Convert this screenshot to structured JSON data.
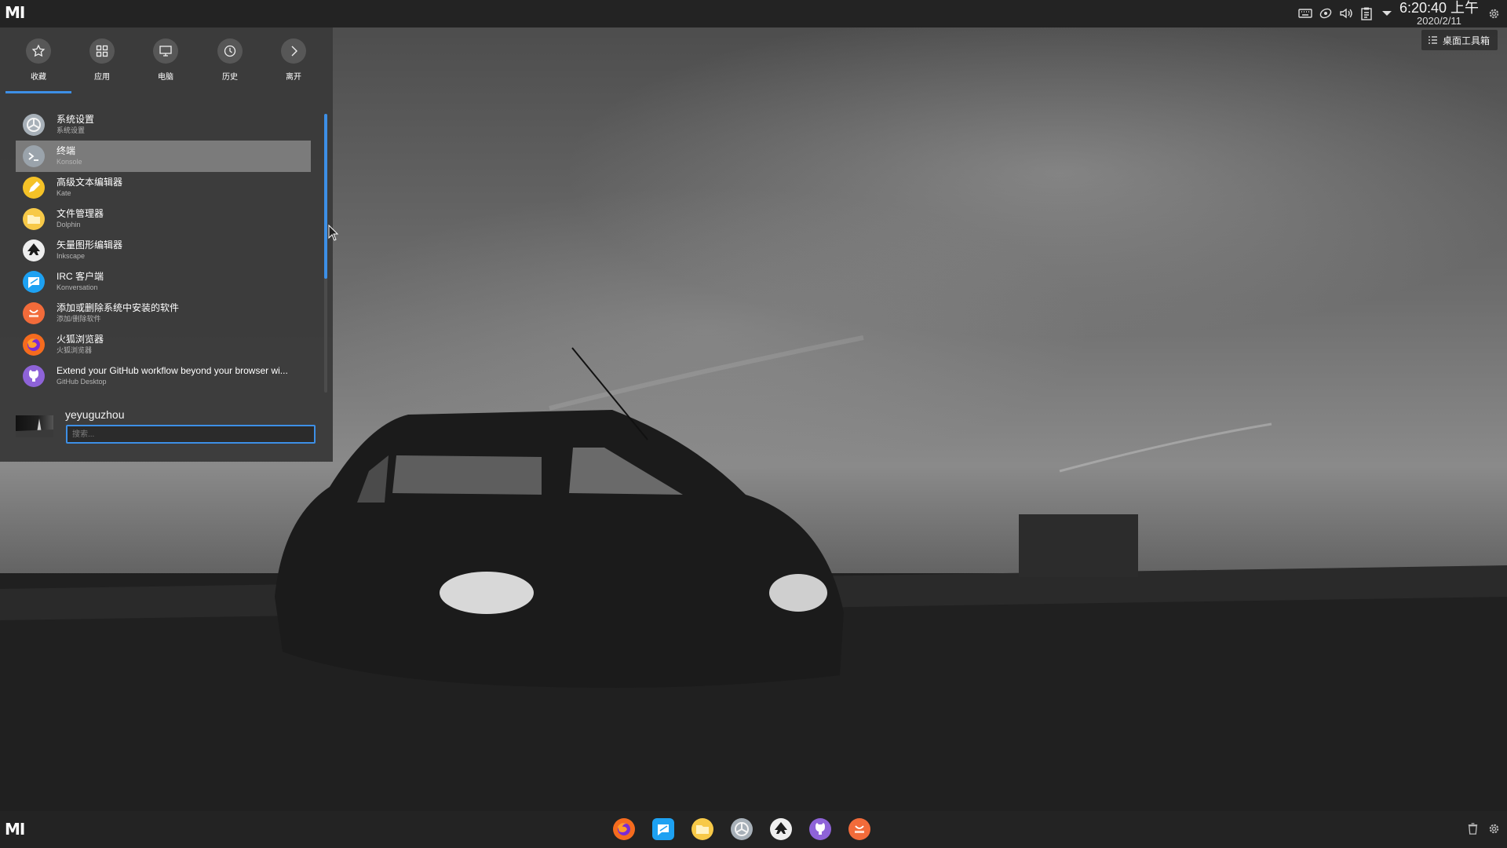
{
  "top_panel": {
    "logo": "MI",
    "tray_icons": [
      "keyboard-icon",
      "network-icon",
      "volume-icon",
      "clipboard-icon",
      "expand-arrow-icon"
    ],
    "clock_time": "6:20:40 上午",
    "clock_date": "2020/2/11"
  },
  "desktop_toolbox": {
    "label": "桌面工具箱"
  },
  "launcher": {
    "tabs": [
      {
        "label": "收藏",
        "icon": "star-icon"
      },
      {
        "label": "应用",
        "icon": "grid-icon"
      },
      {
        "label": "电脑",
        "icon": "monitor-icon"
      },
      {
        "label": "历史",
        "icon": "clock-icon"
      },
      {
        "label": "离开",
        "icon": "chevron-right-icon"
      }
    ],
    "active_tab": "收藏",
    "apps": [
      {
        "name": "系统设置",
        "sub": "系统设置",
        "icon": "settings-icon",
        "color": "#a7b0b8"
      },
      {
        "name": "终端",
        "sub": "Konsole",
        "icon": "terminal-icon",
        "color": "#9aa3ab"
      },
      {
        "name": "高级文本编辑器",
        "sub": "Kate",
        "icon": "pencil-icon",
        "color": "#f5c227"
      },
      {
        "name": "文件管理器",
        "sub": "Dolphin",
        "icon": "folder-icon",
        "color": "#f7c948"
      },
      {
        "name": "矢量图形编辑器",
        "sub": "Inkscape",
        "icon": "inkscape-icon",
        "color": "#eeeeee"
      },
      {
        "name": "IRC 客户端",
        "sub": "Konversation",
        "icon": "chat-icon",
        "color": "#1da1f2"
      },
      {
        "name": "添加或删除系统中安装的软件",
        "sub": "添加/删除软件",
        "icon": "shop-icon",
        "color": "#f26b3a"
      },
      {
        "name": "火狐浏览器",
        "sub": "火狐浏览器",
        "icon": "firefox-icon",
        "color": "#f56b1e"
      },
      {
        "name": "Extend your GitHub workflow beyond your browser wi...",
        "sub": "GitHub Desktop",
        "icon": "github-icon",
        "color": "#8e63d8"
      }
    ],
    "selected_app": "终端",
    "scroll_position": 0.0,
    "user": {
      "name": "yeyuguzhou"
    },
    "search": {
      "placeholder": "搜索...",
      "value": ""
    }
  },
  "dock": {
    "apps": [
      {
        "name": "firefox",
        "icon": "firefox-icon"
      },
      {
        "name": "konversation",
        "icon": "chat-icon"
      },
      {
        "name": "dolphin",
        "icon": "folder-icon"
      },
      {
        "name": "system-settings",
        "icon": "settings-icon"
      },
      {
        "name": "inkscape",
        "icon": "inkscape-icon"
      },
      {
        "name": "github-desktop",
        "icon": "github-icon"
      },
      {
        "name": "shop",
        "icon": "shop-icon"
      }
    ]
  },
  "bottom_tray": [
    "trash-icon",
    "gear-icon"
  ],
  "colors": {
    "accent": "#3d8fe6",
    "panel": "#232323",
    "launcher_bg": "#3a3a3a"
  }
}
